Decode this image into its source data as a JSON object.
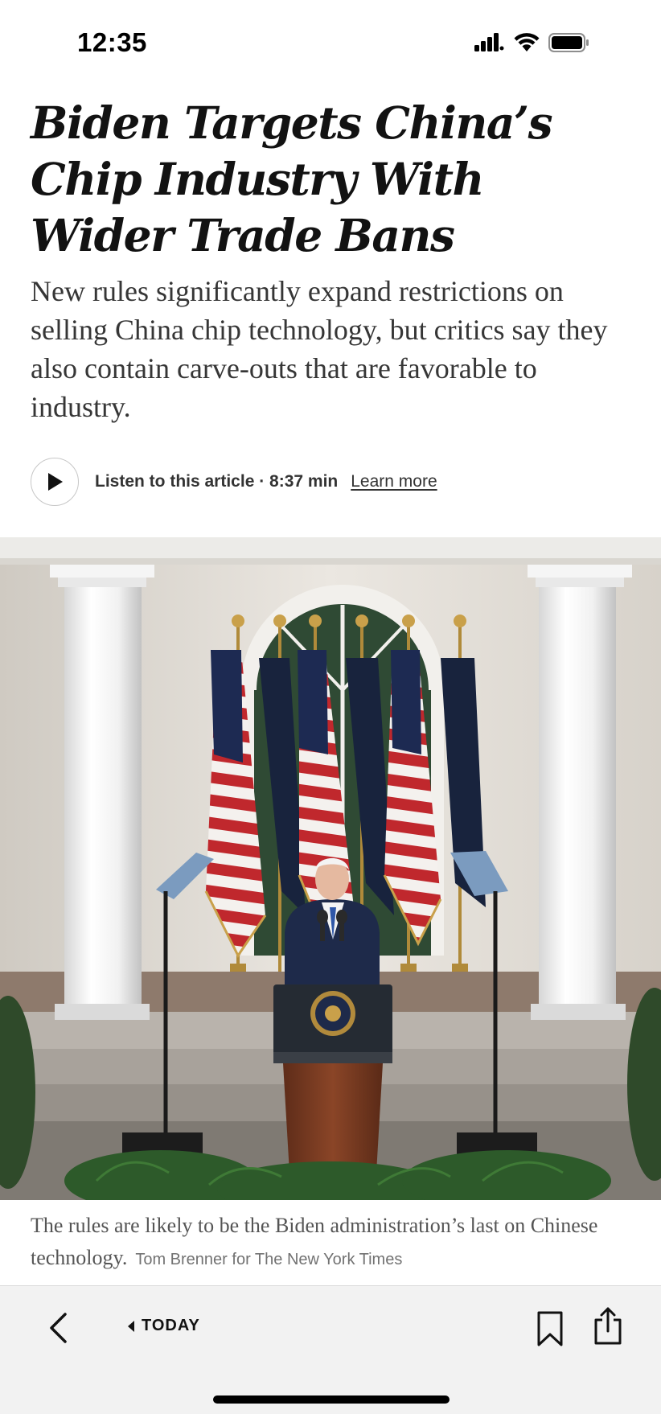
{
  "status_bar": {
    "time": "12:35"
  },
  "article": {
    "headline": "Biden Targets China’s Chip Industry With Wider Trade Bans",
    "summary": "New rules significantly expand restrictions on selling China chip technology, but critics say they also contain carve-outs that are favorable to industry.",
    "listen_label": "Listen to this article · 8:37 min",
    "learn_more": "Learn more",
    "caption": "The rules are likely to be the Biden administration’s last on Chinese technology.",
    "credit": "Tom Brenner for The New York Times"
  },
  "toolbar": {
    "section_label": "TODAY"
  },
  "icons": {
    "play": "play-icon",
    "back": "chevron-left-icon",
    "section_back": "caret-left-icon",
    "bookmark": "bookmark-icon",
    "share": "share-icon",
    "signal": "cellular-signal-icon",
    "wifi": "wifi-icon",
    "battery": "battery-icon"
  },
  "colors": {
    "headline": "#121212",
    "summary": "#363636",
    "toolbar_bg": "#f2f2f2"
  }
}
